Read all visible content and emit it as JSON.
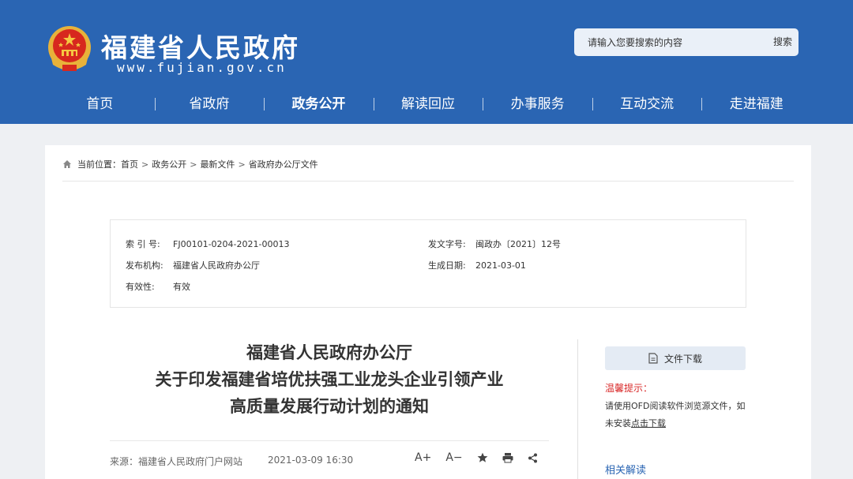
{
  "header": {
    "site_title": "福建省人民政府",
    "site_url": "www.fujian.gov.cn",
    "search_placeholder": "请输入您要搜索的内容",
    "search_button": "搜索"
  },
  "nav": {
    "items": [
      "首页",
      "省政府",
      "政务公开",
      "解读回应",
      "办事服务",
      "互动交流",
      "走进福建"
    ],
    "active": "政务公开"
  },
  "breadcrumb": {
    "prefix": "当前位置：",
    "items": [
      "首页",
      "政务公开",
      "最新文件",
      "省政府办公厅文件"
    ],
    "separator": ">"
  },
  "info": {
    "index_label": "索 引 号:",
    "index_value": "FJ00101-0204-2021-00013",
    "doc_no_label": "发文字号:",
    "doc_no_value": "闽政办〔2021〕12号",
    "issuer_label": "发布机构:",
    "issuer_value": "福建省人民政府办公厅",
    "date_label": "生成日期:",
    "date_value": "2021-03-01",
    "validity_label": "有效性:",
    "validity_value": "有效"
  },
  "document": {
    "title_line1": "福建省人民政府办公厅",
    "title_line2": "关于印发福建省培优扶强工业龙头企业引领产业",
    "title_line3": "高质量发展行动计划的通知",
    "source": "来源：福建省人民政府门户网站",
    "publish_time": "2021-03-09 16:30",
    "font_increase": "A+",
    "font_decrease": "A−"
  },
  "sidebar": {
    "download_label": "文件下载",
    "tip_title": "温馨提示：",
    "tip_text": "请使用OFD阅读软件浏览源文件，如未安装",
    "tip_link": "点击下载",
    "related_label": "相关解读"
  },
  "colors": {
    "header_bg": "#2a65b3",
    "tip_red": "#d92a2a",
    "link_blue": "#2a65b3"
  }
}
